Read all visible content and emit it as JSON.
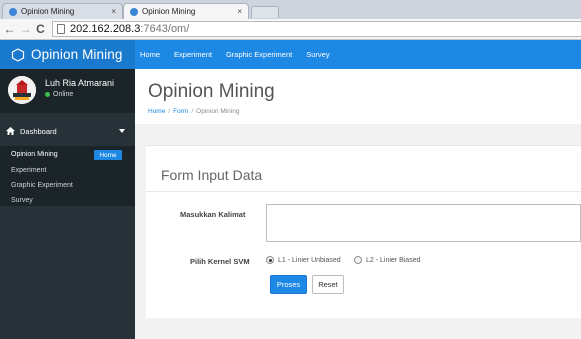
{
  "browser": {
    "tabs": [
      {
        "title": "Opinion Mining",
        "close": "×"
      },
      {
        "title": "Opinion Mining",
        "close": "×"
      }
    ],
    "url_host": "202.162.208.3",
    "url_rest": ":7643/om/",
    "nav": {
      "back": "←",
      "forward": "→",
      "reload": "C"
    }
  },
  "brand": {
    "label": "Opinion Mining"
  },
  "topnav": [
    "Home",
    "Experiment",
    "Graphic Experiment",
    "Survey"
  ],
  "profile": {
    "name": "Luh Ria Atmarani",
    "status": "Online"
  },
  "sidebar": {
    "dashboard_label": "Dashboard",
    "items": [
      {
        "label": "Opinion Mining",
        "badge": "Home"
      },
      {
        "label": "Experiment"
      },
      {
        "label": "Graphic Experiment"
      },
      {
        "label": "Survey"
      }
    ]
  },
  "page": {
    "title": "Opinion Mining",
    "breadcrumb": [
      "Home",
      "Form",
      "Opinion Mining"
    ]
  },
  "form": {
    "title": "Form Input Data",
    "kalimat_label": "Masukkan Kalimat",
    "kalimat_value": "",
    "kernel_label": "Pilih Kernel SVM",
    "kernel_options": [
      {
        "label": "L1 - Linier Unbiased",
        "checked": true
      },
      {
        "label": "L2 - Linier Biased",
        "checked": false
      }
    ],
    "submit_label": "Proses",
    "reset_label": "Reset"
  },
  "colors": {
    "accent": "#1e88e5",
    "sidebar": "#263238",
    "online": "#3cbf4a"
  },
  "icons": {
    "brand": "hexagon-icon",
    "favicon": "globe-icon",
    "dashboard": "home-icon",
    "caret": "caret-down-icon",
    "page": "document-icon"
  }
}
